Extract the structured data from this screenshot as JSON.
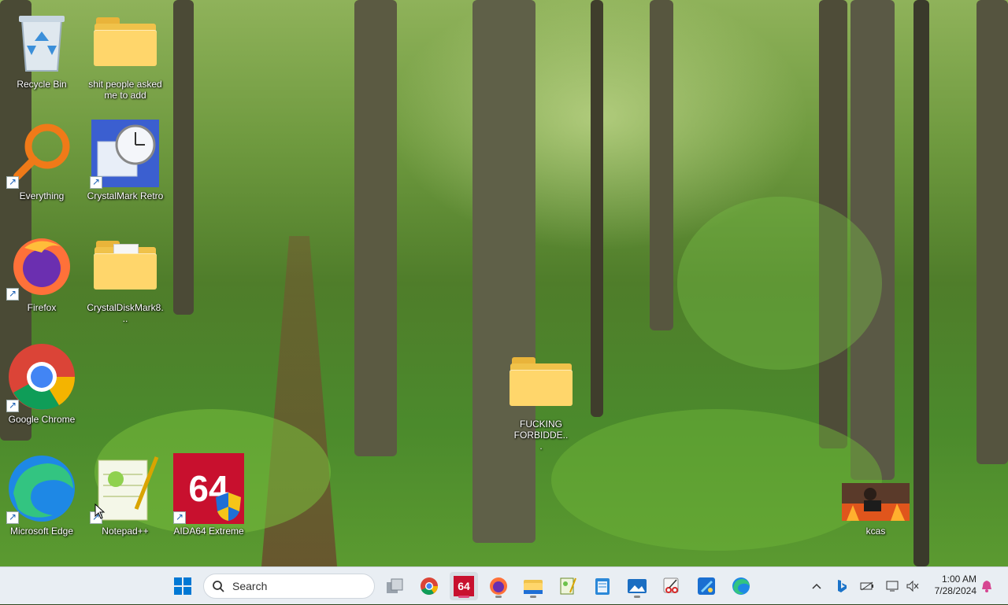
{
  "desktop": {
    "icons": [
      {
        "label": "Recycle Bin",
        "icon": "recycle-bin-icon"
      },
      {
        "label": "shit people asked me to add",
        "icon": "folder-icon"
      },
      {
        "label": "Everything",
        "icon": "everything-search-icon"
      },
      {
        "label": "CrystalMark Retro",
        "icon": "crystalmark-icon"
      },
      {
        "label": "Firefox",
        "icon": "firefox-icon"
      },
      {
        "label": "CrystalDiskMark8...",
        "icon": "folder-icon"
      },
      {
        "label": "Google Chrome",
        "icon": "chrome-icon"
      },
      {
        "label": "Microsoft Edge",
        "icon": "edge-icon"
      },
      {
        "label": "Notepad++",
        "icon": "notepadpp-icon"
      },
      {
        "label": "AIDA64 Extreme",
        "icon": "aida64-icon"
      },
      {
        "label": "FUCKING FORBIDDE...",
        "icon": "folder-icon"
      },
      {
        "label": "kcas",
        "icon": "image-thumbnail-icon"
      }
    ],
    "aida_badge": "64"
  },
  "taskbar": {
    "search_label": "Search",
    "pinned": [
      "start-icon",
      "task-view-icon",
      "chrome-icon",
      "aida64-icon",
      "firefox-icon",
      "file-explorer-icon",
      "notepadpp-icon",
      "notepad-icon",
      "photos-icon",
      "snipping-tool-icon",
      "paint-icon",
      "edge-icon"
    ],
    "aida_badge": "64",
    "clock": {
      "time": "1:00 AM",
      "date": "7/28/2024"
    }
  },
  "colors": {
    "taskbar_bg": "#e9eef3",
    "windows_blue": "#0078d4",
    "aida_red": "#c8102e",
    "folder_yellow": "#ffd66b"
  }
}
